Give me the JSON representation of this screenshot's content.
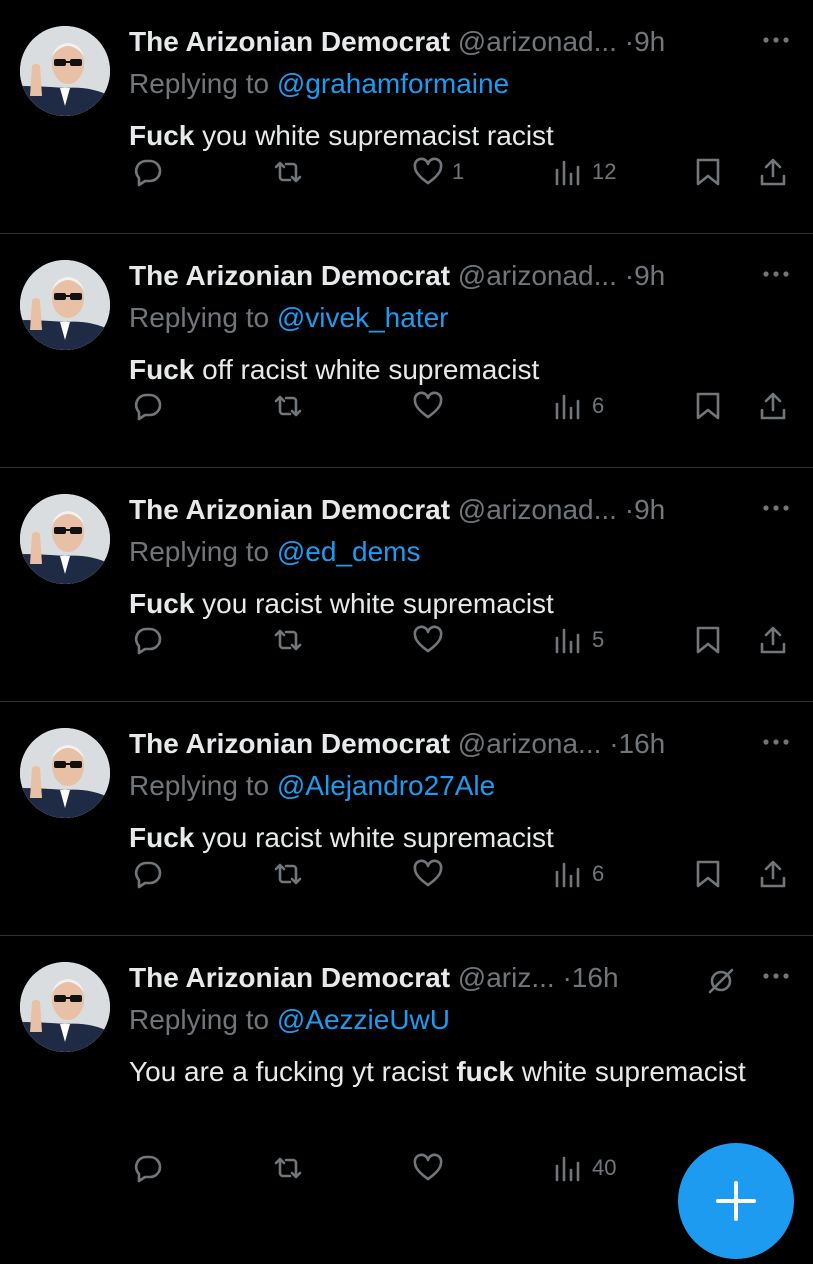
{
  "tweets": [
    {
      "name": "The Arizonian Democrat",
      "handle": "@arizonad...",
      "dot": "·",
      "time": "9h",
      "reply_prefix": "Replying to",
      "reply_to": "@grahamformaine",
      "text_bold": "Fuck",
      "text_rest": " you white supremacist racist",
      "likes": "1",
      "views": "12"
    },
    {
      "name": "The Arizonian Democrat",
      "handle": "@arizonad...",
      "dot": "·",
      "time": "9h",
      "reply_prefix": "Replying to",
      "reply_to": "@vivek_hater",
      "text_bold": "Fuck",
      "text_rest": " off racist white supremacist",
      "likes": "",
      "views": "6"
    },
    {
      "name": "The Arizonian Democrat",
      "handle": "@arizonad...",
      "dot": "·",
      "time": "9h",
      "reply_prefix": "Replying to",
      "reply_to": "@ed_dems",
      "text_bold": "Fuck",
      "text_rest": " you racist white supremacist",
      "likes": "",
      "views": "5"
    },
    {
      "name": "The Arizonian Democrat",
      "handle": "@arizona...",
      "dot": "·",
      "time": "16h",
      "reply_prefix": "Replying to",
      "reply_to": "@Alejandro27Ale",
      "text_bold": "Fuck",
      "text_rest": " you racist white supremacist",
      "likes": "",
      "views": "6"
    },
    {
      "name": "The Arizonian Democrat",
      "handle": "@ariz...",
      "dot": "·",
      "time": "16h",
      "reply_prefix": "Replying to",
      "reply_to": "@AezzieUwU",
      "text_pre": "You are a fucking yt racist ",
      "text_bold": "fuck",
      "text_rest": " white supremacist",
      "likes": "",
      "views": "40"
    }
  ],
  "icons": {
    "reply": "speech-bubble-icon",
    "retweet": "retweet-icon",
    "like": "heart-icon",
    "views": "bar-chart-icon",
    "bookmark": "bookmark-icon",
    "share": "share-icon",
    "more": "ellipsis-icon",
    "muted": "muted-icon",
    "compose": "plus-icon"
  },
  "colors": {
    "background": "#000000",
    "text": "#e7e9ea",
    "muted_text": "#71767b",
    "accent": "#1d9bf0",
    "divider": "#2f3336"
  }
}
